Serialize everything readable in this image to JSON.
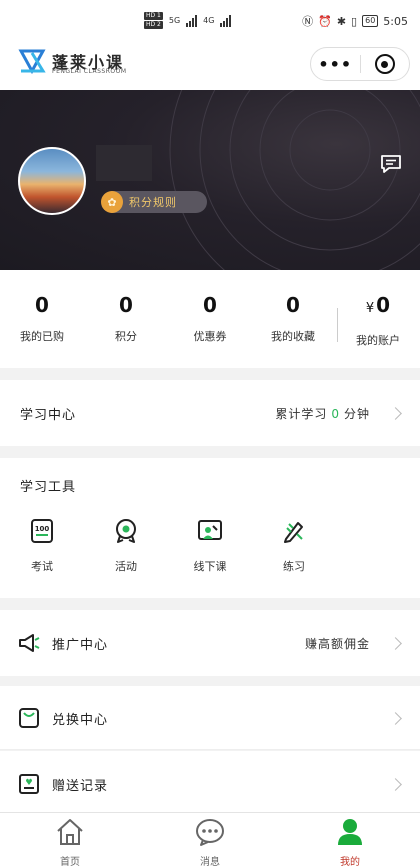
{
  "status_bar": {
    "hd1": "HD 1",
    "hd2": "HD 2",
    "net1": "5G",
    "net2": "4G",
    "battery": "60",
    "time": "5:05"
  },
  "title_bar": {
    "brand": "蓬莱小课",
    "brand_sub": "PENGLAI CLASSROOM",
    "more_label": "•••"
  },
  "profile": {
    "points_rule_label": "积分规则"
  },
  "stats": [
    {
      "value": "0",
      "label": "我的已购"
    },
    {
      "value": "0",
      "label": "积分"
    },
    {
      "value": "0",
      "label": "优惠券"
    },
    {
      "value": "0",
      "label": "我的收藏"
    },
    {
      "currency": "¥",
      "value": "0",
      "label": "我的账户"
    }
  ],
  "learning_center": {
    "title": "学习中心",
    "prefix": "累计学习",
    "minutes": "0",
    "suffix": "分钟"
  },
  "tools": {
    "title": "学习工具",
    "items": [
      {
        "label": "考试",
        "icon": "exam-icon"
      },
      {
        "label": "活动",
        "icon": "activity-icon"
      },
      {
        "label": "线下课",
        "icon": "offline-class-icon"
      },
      {
        "label": "练习",
        "icon": "practice-icon"
      }
    ]
  },
  "promotion": {
    "title": "推广中心",
    "right_text": "赚高额佣金"
  },
  "exchange": {
    "title": "兑换中心"
  },
  "gift_records": {
    "title": "赠送记录"
  },
  "tab_bar": {
    "items": [
      {
        "label": "首页",
        "icon": "home-icon"
      },
      {
        "label": "消息",
        "icon": "message-icon"
      },
      {
        "label": "我的",
        "icon": "profile-icon",
        "active": true
      }
    ]
  },
  "colors": {
    "accent_green": "#2bb65a",
    "banner_dark": "#25212a",
    "points_gold": "#e9a23b",
    "active_tab": "#c0392b"
  }
}
